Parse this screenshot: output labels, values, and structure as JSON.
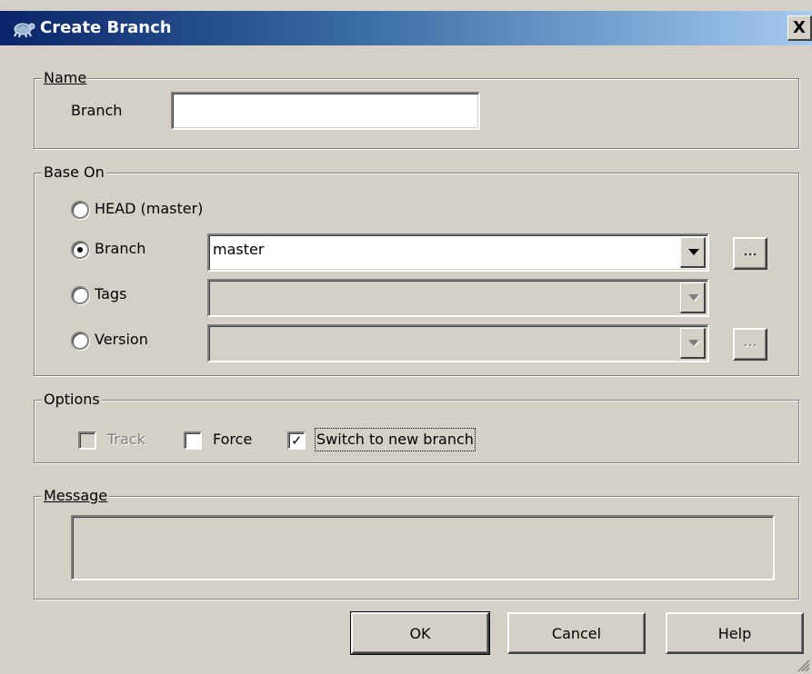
{
  "window": {
    "title": "Create Branch",
    "icon": "tortoise-git-icon",
    "close_label": "X"
  },
  "name_group": {
    "legend": "Name",
    "branch_label": "Branch",
    "branch_value": ""
  },
  "base_on": {
    "legend": "Base On",
    "head_label": "HEAD (master)",
    "branch_label": "Branch",
    "branch_value": "master",
    "tags_label": "Tags",
    "tags_value": "",
    "version_label": "Version",
    "version_value": "",
    "browse_label": "...",
    "selected": "Branch"
  },
  "options": {
    "legend": "Options",
    "track_label": "Track",
    "track_checked": false,
    "track_enabled": false,
    "force_label": "Force",
    "force_checked": false,
    "switch_label": "Switch to new branch",
    "switch_checked": true
  },
  "message": {
    "legend": "Message",
    "value": ""
  },
  "buttons": {
    "ok": "OK",
    "cancel": "Cancel",
    "help": "Help"
  },
  "colors": {
    "dialog_bg": "#d4d0c8",
    "title_start": "#0a246a",
    "title_end": "#a6caf0"
  }
}
